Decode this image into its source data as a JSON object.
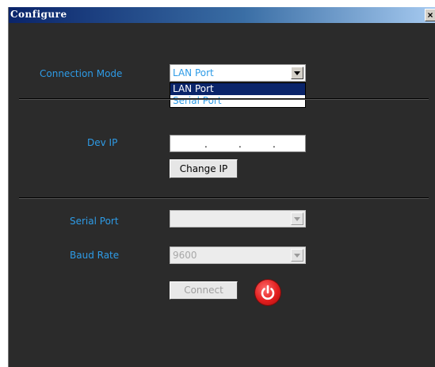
{
  "window": {
    "title": "Configure",
    "close_label": "×"
  },
  "connection": {
    "label": "Connection Mode",
    "selected": "LAN Port",
    "options": [
      "LAN Port",
      "Serial Port"
    ]
  },
  "network": {
    "dev_ip_label": "Dev IP",
    "ip_separators": [
      ".",
      ".",
      "."
    ],
    "change_ip_label": "Change IP"
  },
  "serial": {
    "serial_port_label": "Serial Port",
    "serial_port_value": "",
    "baud_rate_label": "Baud Rate",
    "baud_rate_value": "9600",
    "connect_label": "Connect"
  },
  "icons": {
    "power": "power-icon",
    "dropdown_arrow": "chevron-down-icon"
  },
  "colors": {
    "label": "#2e9be6",
    "background": "#2b2b2b",
    "selection": "#0a246a",
    "power": "#e21e1e"
  }
}
